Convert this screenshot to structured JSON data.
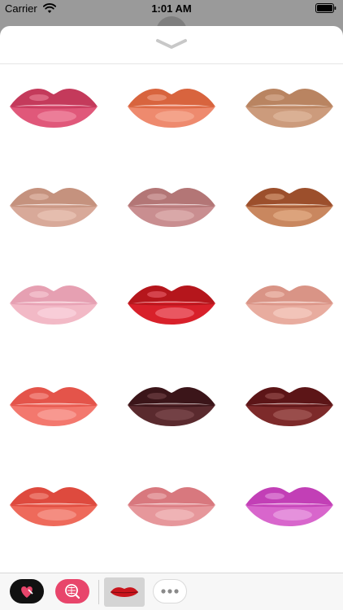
{
  "status_bar": {
    "carrier": "Carrier",
    "time": "1:01 AM",
    "wifi_icon": "wifi-icon",
    "battery_icon": "battery-icon"
  },
  "stickers": [
    {
      "name": "lips-magenta-pink",
      "top": "#c43a5b",
      "bottom": "#e0587a",
      "highlight": "#f08aa3"
    },
    {
      "name": "lips-coral-orange",
      "top": "#d8643e",
      "bottom": "#ee8a6e",
      "highlight": "#f6ab94"
    },
    {
      "name": "lips-tan-nude",
      "top": "#b98461",
      "bottom": "#cc9b7c",
      "highlight": "#dfb79c"
    },
    {
      "name": "lips-soft-nude",
      "top": "#c5927e",
      "bottom": "#d8a999",
      "highlight": "#e9c4b6"
    },
    {
      "name": "lips-dusty-mauve",
      "top": "#b37676",
      "bottom": "#c98e90",
      "highlight": "#ddb0b0"
    },
    {
      "name": "lips-bronze-brown",
      "top": "#9c4f2c",
      "bottom": "#c9875f",
      "highlight": "#e2ac86"
    },
    {
      "name": "lips-baby-pink",
      "top": "#e6a0b2",
      "bottom": "#f2b9c6",
      "highlight": "#f9d4dd"
    },
    {
      "name": "lips-classic-red",
      "top": "#b5161c",
      "bottom": "#d8202a",
      "highlight": "#ef6a74"
    },
    {
      "name": "lips-peach-nude",
      "top": "#d99486",
      "bottom": "#e8ac9f",
      "highlight": "#f5ccc1"
    },
    {
      "name": "lips-salmon-coral",
      "top": "#e4544a",
      "bottom": "#f3786e",
      "highlight": "#f9a39c"
    },
    {
      "name": "lips-dark-plum",
      "top": "#3b1519",
      "bottom": "#5a2a2e",
      "highlight": "#7c4a4e"
    },
    {
      "name": "lips-burgundy",
      "top": "#5c1517",
      "bottom": "#7d2a2a",
      "highlight": "#a35a57"
    },
    {
      "name": "lips-tomato-red",
      "top": "#de4a3e",
      "bottom": "#ee6a5b",
      "highlight": "#f69a8e"
    },
    {
      "name": "lips-rose-pink",
      "top": "#d8787e",
      "bottom": "#e6979b",
      "highlight": "#f1bcbd"
    },
    {
      "name": "lips-orchid-purple",
      "top": "#c23fb6",
      "bottom": "#d866cc",
      "highlight": "#eaa0e1"
    }
  ],
  "tray": {
    "items": [
      {
        "name": "app-heart-icon",
        "bg": "#111111",
        "fg": "#e8456b"
      },
      {
        "name": "app-search-store-icon",
        "bg": "#e8456b",
        "fg": "#ffffff"
      },
      {
        "name": "app-lips-sticker-icon",
        "bg": "#d4d4d4",
        "fg": "#c9151d"
      },
      {
        "name": "more-icon",
        "bg": "#ffffff",
        "fg": "#8a8a8a"
      }
    ]
  }
}
